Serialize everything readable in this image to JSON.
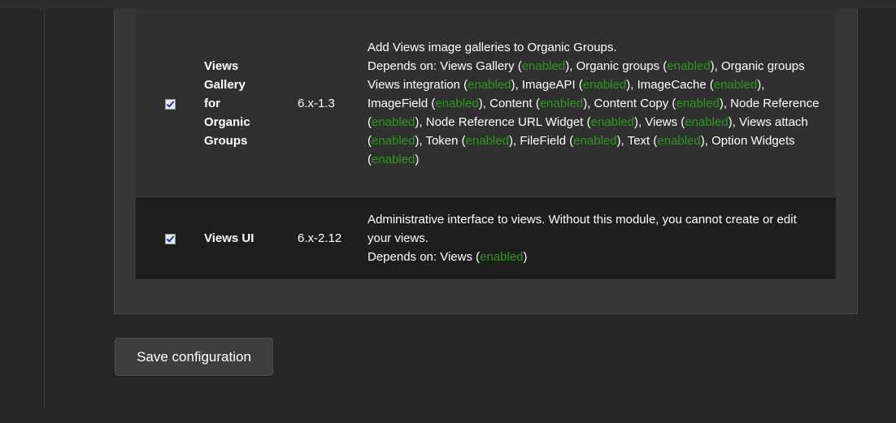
{
  "modules": [
    {
      "name": "Views Gallery for Organic Groups",
      "name_lines": [
        "Views",
        "Gallery",
        "for",
        "Organic",
        "Groups"
      ],
      "version": "6.x-1.3",
      "enabled": true,
      "description": "Add Views image galleries to Organic Groups.",
      "depends_label": "Depends on: ",
      "dependencies": [
        {
          "name": "Views Gallery",
          "status": "enabled"
        },
        {
          "name": "Organic groups",
          "status": "enabled"
        },
        {
          "name": "Organic groups Views integration",
          "status": "enabled"
        },
        {
          "name": "ImageAPI",
          "status": "enabled"
        },
        {
          "name": "ImageCache",
          "status": "enabled"
        },
        {
          "name": "ImageField",
          "status": "enabled"
        },
        {
          "name": "Content",
          "status": "enabled"
        },
        {
          "name": "Content Copy",
          "status": "enabled"
        },
        {
          "name": "Node Reference",
          "status": "enabled"
        },
        {
          "name": "Node Reference URL Widget",
          "status": "enabled"
        },
        {
          "name": "Views",
          "status": "enabled"
        },
        {
          "name": "Views attach",
          "status": "enabled"
        },
        {
          "name": "Token",
          "status": "enabled"
        },
        {
          "name": "FileField",
          "status": "enabled"
        },
        {
          "name": "Text",
          "status": "enabled"
        },
        {
          "name": "Option Widgets",
          "status": "enabled"
        }
      ]
    },
    {
      "name": "Views UI",
      "name_lines": [
        "Views UI"
      ],
      "version": "6.x-2.12",
      "enabled": true,
      "description": "Administrative interface to views. Without this module, you cannot create or edit your views.",
      "depends_label": "Depends on: ",
      "dependencies": [
        {
          "name": "Views",
          "status": "enabled"
        }
      ]
    }
  ],
  "save_button": {
    "label": "Save configuration"
  },
  "colors": {
    "background": "#262626",
    "fieldset": "#363636",
    "row_odd": "#303030",
    "row_even": "#1e1e1e",
    "enabled_status": "#2b9a1c",
    "text": "#ffffff"
  }
}
